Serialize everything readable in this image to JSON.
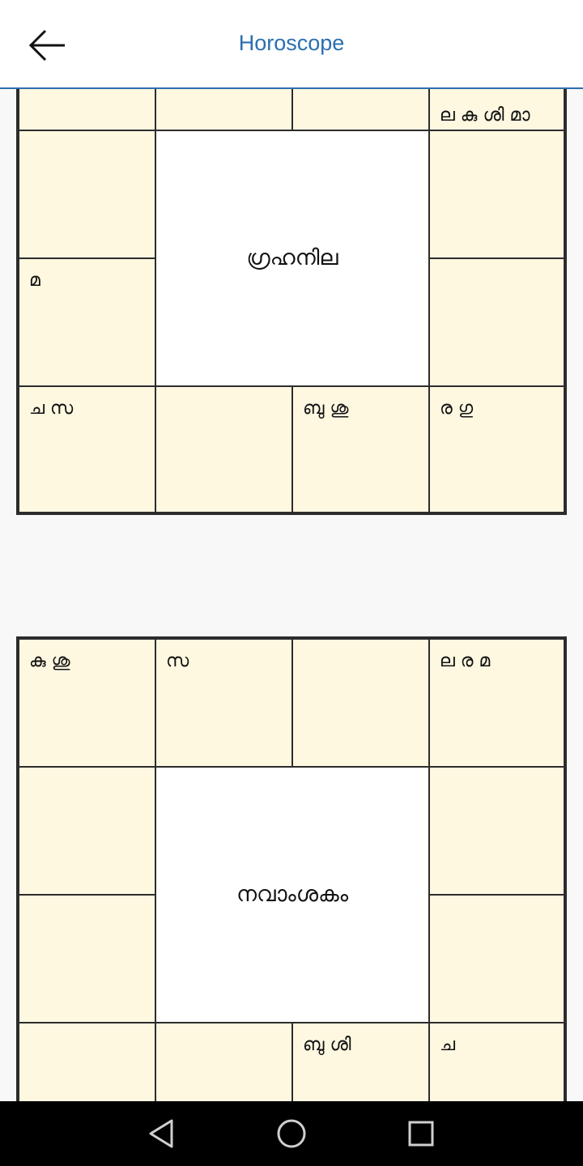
{
  "header": {
    "title": "Horoscope"
  },
  "charts": [
    {
      "center_label": "ഗ്രഹനില",
      "cells": [
        "",
        "",
        "",
        "ല കു ശി മാ",
        "",
        "",
        "മ",
        "",
        "ച സ",
        "",
        "ബു ശു",
        "ര ഗു"
      ]
    },
    {
      "center_label": "നവാംശകം",
      "cells": [
        "കു ശു",
        "സ",
        "",
        "ല ര മ",
        "",
        "",
        "",
        "",
        "",
        "",
        "ബു ശി",
        "ച"
      ]
    }
  ],
  "navigation": {
    "icons": [
      "back-triangle-icon",
      "home-circle-icon",
      "recents-square-icon"
    ]
  }
}
